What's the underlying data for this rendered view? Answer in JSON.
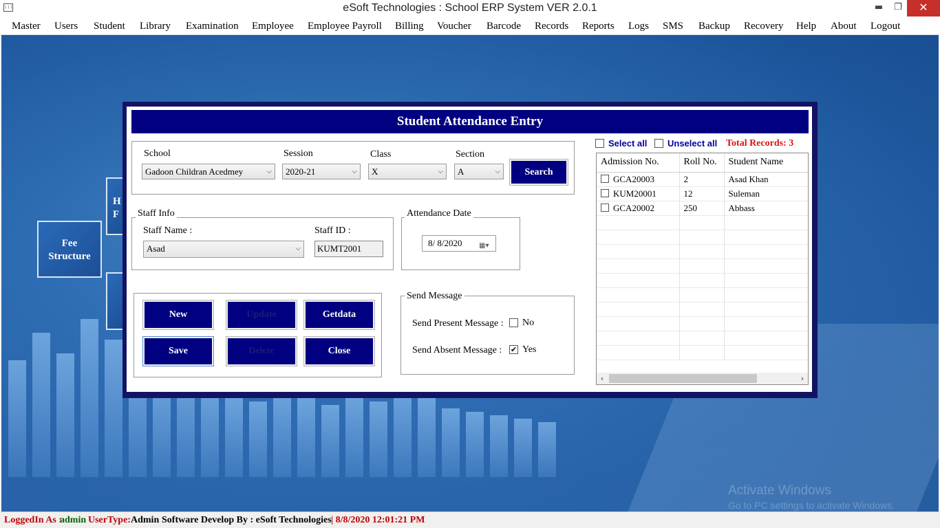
{
  "window": {
    "app_icon": ":::",
    "title": "eSoft Technologies : School ERP System VER 2.0.1",
    "minimize": "▬",
    "maximize": "❐",
    "close": "✕"
  },
  "menu": [
    "Master",
    "Users",
    "Student",
    "Library",
    "Examination",
    "Employee",
    "Employee Payroll",
    "Billing",
    "Voucher",
    "Barcode",
    "Records",
    "Reports",
    "Logs",
    "SMS",
    "Backup",
    "Recovery",
    "Help",
    "About",
    "Logout"
  ],
  "desktop": {
    "tile_fee_line1": "Fee",
    "tile_fee_line2": "Structure",
    "tile_partial_1a": "H",
    "tile_partial_1b": "F",
    "activate_title": "Activate Windows",
    "activate_sub": "Go to PC settings to activate Windows."
  },
  "dialog": {
    "title": "Student Attendance Entry",
    "school_label": "School",
    "school_value": "Gadoon Childran Acedmey",
    "session_label": "Session",
    "session_value": "2020-21",
    "class_label": "Class",
    "class_value": "X",
    "section_label": "Section",
    "section_value": "A",
    "search_button": "Search",
    "staff_info_legend": "Staff Info",
    "staff_name_label": "Staff Name :",
    "staff_name_value": "Asad",
    "staff_id_label": "Staff ID :",
    "staff_id_value": "KUMT2001",
    "attendance_date_legend": "Attendance Date",
    "attendance_date_value": "8/  8/2020",
    "buttons": {
      "new": "New",
      "update": "Update",
      "getdata": "Getdata",
      "save": "Save",
      "delete": "Delete",
      "close": "Close"
    },
    "send_message_legend": "Send Message",
    "send_present_label": "Send Present Message :",
    "send_present_value": "No",
    "send_present_checked": false,
    "send_absent_label": "Send Absent Message :",
    "send_absent_value": "Yes",
    "send_absent_checked": true,
    "select_all": "Select all",
    "unselect_all": "Unselect all",
    "total_records": "Total Records: 3",
    "grid": {
      "columns": [
        "Admission No.",
        "Roll No.",
        "Student Name"
      ],
      "rows": [
        [
          "GCA20003",
          "2",
          "Asad Khan"
        ],
        [
          "KUM20001",
          "12",
          "Suleman"
        ],
        [
          "GCA20002",
          "250",
          "Abbass"
        ]
      ]
    }
  },
  "status": {
    "logged_label": "LoggedIn As :",
    "logged_value": "admin",
    "usertype_label": "UserType:",
    "usertype_value": "Admin",
    "developer": "Software Develop By : eSoft Technologies",
    "datetime": "| 8/8/2020 12:01:21 PM"
  },
  "colors": {
    "header_blue": "#000080",
    "dialog_border": "#131363",
    "total_red": "#e01010",
    "status_green": "#006400",
    "status_red": "#c00000"
  }
}
